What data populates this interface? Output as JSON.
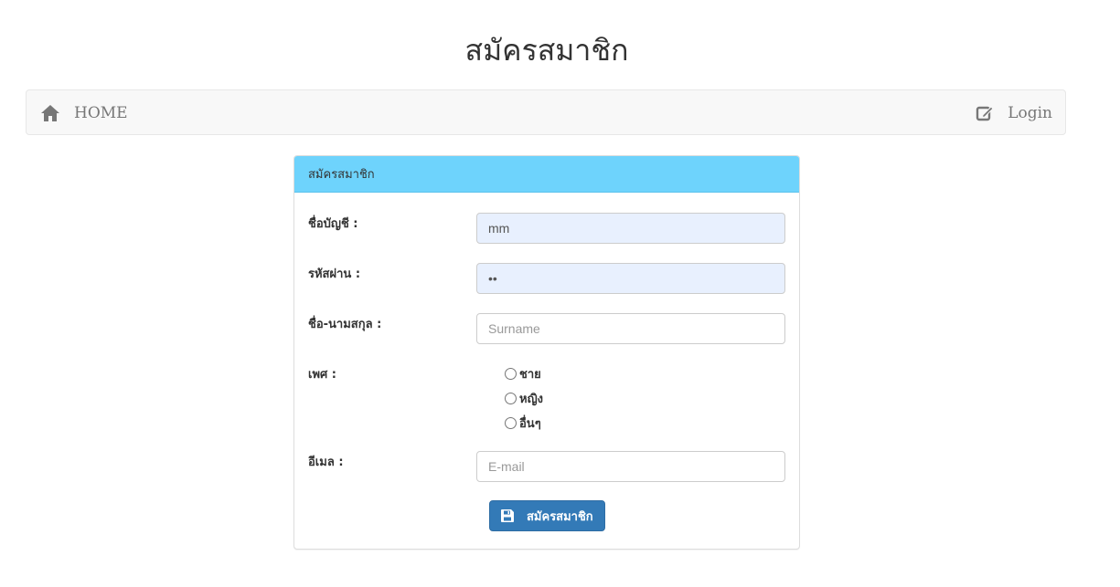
{
  "page": {
    "title": "สมัครสมาชิก"
  },
  "navbar": {
    "home_label": "HOME",
    "login_label": "Login",
    "home_icon": "home-icon",
    "login_icon": "edit-icon"
  },
  "panel": {
    "heading": "สมัครสมาชิก"
  },
  "form": {
    "username_label": "ชื่อบัญชี :",
    "username_value": "mm",
    "password_label": "รหัสผ่าน :",
    "password_value": "mm",
    "fullname_label": "ชื่อ-นามสกุล :",
    "fullname_placeholder": "Surname",
    "gender_label": "เพศ :",
    "gender_options": [
      "ชาย",
      "หญิง",
      "อื่นๆ"
    ],
    "email_label": "อีเมล :",
    "email_placeholder": "E-mail",
    "submit_label": "สมัครสมาชิก",
    "submit_icon": "floppy-disk-icon"
  },
  "colors": {
    "panel_heading": "#6ed3fc",
    "button": "#337ab7",
    "autofill": "#e8f0fe"
  }
}
